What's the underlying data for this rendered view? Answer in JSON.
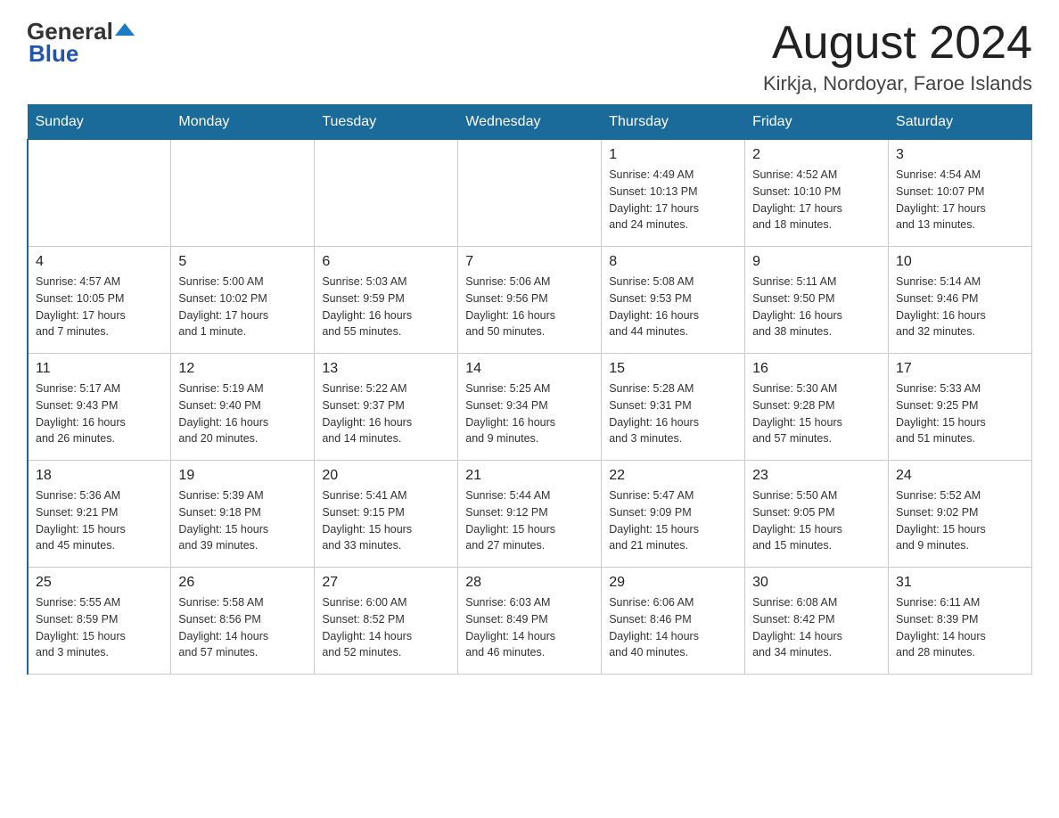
{
  "header": {
    "logo_general": "General",
    "logo_blue": "Blue",
    "title": "August 2024",
    "location": "Kirkja, Nordoyar, Faroe Islands"
  },
  "days_of_week": [
    "Sunday",
    "Monday",
    "Tuesday",
    "Wednesday",
    "Thursday",
    "Friday",
    "Saturday"
  ],
  "weeks": [
    [
      {
        "day": "",
        "info": ""
      },
      {
        "day": "",
        "info": ""
      },
      {
        "day": "",
        "info": ""
      },
      {
        "day": "",
        "info": ""
      },
      {
        "day": "1",
        "info": "Sunrise: 4:49 AM\nSunset: 10:13 PM\nDaylight: 17 hours\nand 24 minutes."
      },
      {
        "day": "2",
        "info": "Sunrise: 4:52 AM\nSunset: 10:10 PM\nDaylight: 17 hours\nand 18 minutes."
      },
      {
        "day": "3",
        "info": "Sunrise: 4:54 AM\nSunset: 10:07 PM\nDaylight: 17 hours\nand 13 minutes."
      }
    ],
    [
      {
        "day": "4",
        "info": "Sunrise: 4:57 AM\nSunset: 10:05 PM\nDaylight: 17 hours\nand 7 minutes."
      },
      {
        "day": "5",
        "info": "Sunrise: 5:00 AM\nSunset: 10:02 PM\nDaylight: 17 hours\nand 1 minute."
      },
      {
        "day": "6",
        "info": "Sunrise: 5:03 AM\nSunset: 9:59 PM\nDaylight: 16 hours\nand 55 minutes."
      },
      {
        "day": "7",
        "info": "Sunrise: 5:06 AM\nSunset: 9:56 PM\nDaylight: 16 hours\nand 50 minutes."
      },
      {
        "day": "8",
        "info": "Sunrise: 5:08 AM\nSunset: 9:53 PM\nDaylight: 16 hours\nand 44 minutes."
      },
      {
        "day": "9",
        "info": "Sunrise: 5:11 AM\nSunset: 9:50 PM\nDaylight: 16 hours\nand 38 minutes."
      },
      {
        "day": "10",
        "info": "Sunrise: 5:14 AM\nSunset: 9:46 PM\nDaylight: 16 hours\nand 32 minutes."
      }
    ],
    [
      {
        "day": "11",
        "info": "Sunrise: 5:17 AM\nSunset: 9:43 PM\nDaylight: 16 hours\nand 26 minutes."
      },
      {
        "day": "12",
        "info": "Sunrise: 5:19 AM\nSunset: 9:40 PM\nDaylight: 16 hours\nand 20 minutes."
      },
      {
        "day": "13",
        "info": "Sunrise: 5:22 AM\nSunset: 9:37 PM\nDaylight: 16 hours\nand 14 minutes."
      },
      {
        "day": "14",
        "info": "Sunrise: 5:25 AM\nSunset: 9:34 PM\nDaylight: 16 hours\nand 9 minutes."
      },
      {
        "day": "15",
        "info": "Sunrise: 5:28 AM\nSunset: 9:31 PM\nDaylight: 16 hours\nand 3 minutes."
      },
      {
        "day": "16",
        "info": "Sunrise: 5:30 AM\nSunset: 9:28 PM\nDaylight: 15 hours\nand 57 minutes."
      },
      {
        "day": "17",
        "info": "Sunrise: 5:33 AM\nSunset: 9:25 PM\nDaylight: 15 hours\nand 51 minutes."
      }
    ],
    [
      {
        "day": "18",
        "info": "Sunrise: 5:36 AM\nSunset: 9:21 PM\nDaylight: 15 hours\nand 45 minutes."
      },
      {
        "day": "19",
        "info": "Sunrise: 5:39 AM\nSunset: 9:18 PM\nDaylight: 15 hours\nand 39 minutes."
      },
      {
        "day": "20",
        "info": "Sunrise: 5:41 AM\nSunset: 9:15 PM\nDaylight: 15 hours\nand 33 minutes."
      },
      {
        "day": "21",
        "info": "Sunrise: 5:44 AM\nSunset: 9:12 PM\nDaylight: 15 hours\nand 27 minutes."
      },
      {
        "day": "22",
        "info": "Sunrise: 5:47 AM\nSunset: 9:09 PM\nDaylight: 15 hours\nand 21 minutes."
      },
      {
        "day": "23",
        "info": "Sunrise: 5:50 AM\nSunset: 9:05 PM\nDaylight: 15 hours\nand 15 minutes."
      },
      {
        "day": "24",
        "info": "Sunrise: 5:52 AM\nSunset: 9:02 PM\nDaylight: 15 hours\nand 9 minutes."
      }
    ],
    [
      {
        "day": "25",
        "info": "Sunrise: 5:55 AM\nSunset: 8:59 PM\nDaylight: 15 hours\nand 3 minutes."
      },
      {
        "day": "26",
        "info": "Sunrise: 5:58 AM\nSunset: 8:56 PM\nDaylight: 14 hours\nand 57 minutes."
      },
      {
        "day": "27",
        "info": "Sunrise: 6:00 AM\nSunset: 8:52 PM\nDaylight: 14 hours\nand 52 minutes."
      },
      {
        "day": "28",
        "info": "Sunrise: 6:03 AM\nSunset: 8:49 PM\nDaylight: 14 hours\nand 46 minutes."
      },
      {
        "day": "29",
        "info": "Sunrise: 6:06 AM\nSunset: 8:46 PM\nDaylight: 14 hours\nand 40 minutes."
      },
      {
        "day": "30",
        "info": "Sunrise: 6:08 AM\nSunset: 8:42 PM\nDaylight: 14 hours\nand 34 minutes."
      },
      {
        "day": "31",
        "info": "Sunrise: 6:11 AM\nSunset: 8:39 PM\nDaylight: 14 hours\nand 28 minutes."
      }
    ]
  ]
}
